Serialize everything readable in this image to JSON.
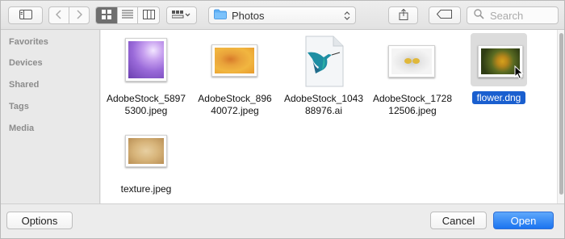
{
  "toolbar": {
    "location_label": "Photos",
    "search_placeholder": "Search"
  },
  "sidebar": {
    "sections": [
      "Favorites",
      "Devices",
      "Shared",
      "Tags",
      "Media"
    ]
  },
  "files": [
    {
      "name": "AdobeStock_58975300.jpeg",
      "line1": "AdobeStock_5897",
      "line2": "5300.jpeg"
    },
    {
      "name": "AdobeStock_89640072.jpeg",
      "line1": "AdobeStock_896",
      "line2": "40072.jpeg"
    },
    {
      "name": "AdobeStock_104388976.ai",
      "line1": "AdobeStock_1043",
      "line2": "88976.ai"
    },
    {
      "name": "AdobeStock_172812506.jpeg",
      "line1": "AdobeStock_1728",
      "line2": "12506.jpeg"
    },
    {
      "name": "flower.dng",
      "line1": "flower.dng",
      "line2": ""
    },
    {
      "name": "texture.jpeg",
      "line1": "texture.jpeg",
      "line2": ""
    }
  ],
  "selected_file": "flower.dng",
  "buttons": {
    "options": "Options",
    "cancel": "Cancel",
    "open": "Open"
  },
  "colors": {
    "accent": "#1b74f0",
    "selection": "#1a5fcf"
  },
  "icons": [
    "sidebar-toggle-icon",
    "back-icon",
    "forward-icon",
    "icon-view-icon",
    "list-view-icon",
    "column-view-icon",
    "arrange-icon",
    "folder-icon",
    "updown-icon",
    "share-icon",
    "tag-icon",
    "search-icon"
  ]
}
